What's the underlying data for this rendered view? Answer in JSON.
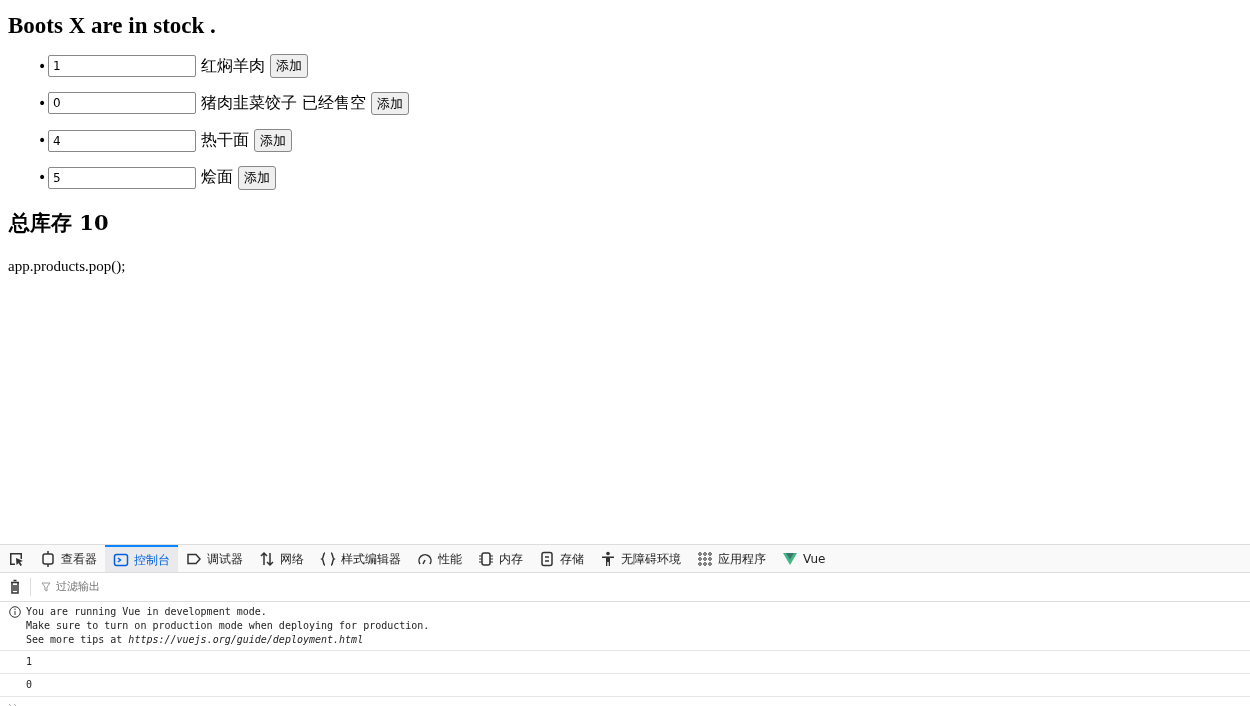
{
  "page": {
    "title": "Boots X are in stock .",
    "products": [
      {
        "marker": "•",
        "quantity": "1",
        "name": "红焖羊肉",
        "button": "添加"
      },
      {
        "marker": "•",
        "quantity": "0",
        "name": "猪肉韭菜饺子",
        "note": "已经售空",
        "button": "添加"
      },
      {
        "marker": "•",
        "quantity": "4",
        "name": "热干面",
        "button": "添加"
      },
      {
        "marker": "•",
        "quantity": "5",
        "name": "烩面",
        "button": "添加"
      }
    ],
    "total": "总库存 10",
    "code": "app.products.pop();"
  },
  "devtools": {
    "tabs": [
      {
        "kind": "inspector",
        "label": "查看器",
        "selected": false
      },
      {
        "kind": "console",
        "label": "控制台",
        "selected": true
      },
      {
        "kind": "debugger",
        "label": "调试器",
        "selected": false
      },
      {
        "kind": "network",
        "label": "网络",
        "selected": false
      },
      {
        "kind": "style",
        "label": "样式编辑器",
        "selected": false
      },
      {
        "kind": "performance",
        "label": "性能",
        "selected": false
      },
      {
        "kind": "memory",
        "label": "内存",
        "selected": false
      },
      {
        "kind": "storage",
        "label": "存储",
        "selected": false
      },
      {
        "kind": "accessibility",
        "label": "无障碍环境",
        "selected": false
      },
      {
        "kind": "application",
        "label": "应用程序",
        "selected": false
      },
      {
        "kind": "vue",
        "label": "Vue",
        "selected": false
      }
    ],
    "filter": {
      "placeholder": "过滤输出"
    },
    "messages": [
      {
        "kind": "info",
        "lines": [
          "You are running Vue in development mode.",
          "Make sure to turn on production mode when deploying for production.",
          "See more tips at *https://vuejs.org/guide/deployment.html*"
        ]
      },
      {
        "kind": "log",
        "lines": [
          "1"
        ]
      },
      {
        "kind": "log",
        "lines": [
          "0"
        ]
      }
    ]
  }
}
